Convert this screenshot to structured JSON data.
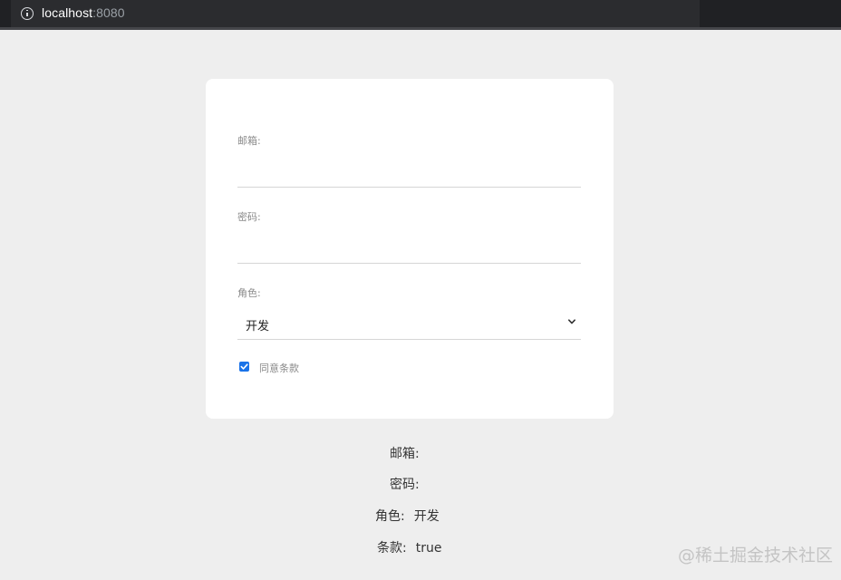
{
  "browser": {
    "url_host": "localhost",
    "url_port": ":8080"
  },
  "form": {
    "email_label": "邮箱:",
    "email_value": "",
    "password_label": "密码:",
    "password_value": "",
    "role_label": "角色:",
    "role_value": "开发",
    "terms_label": "同意条款",
    "terms_checked": true
  },
  "summary": {
    "email_label": "邮箱:",
    "email_value": "",
    "password_label": "密码:",
    "password_value": "",
    "role_label": "角色:",
    "role_value": "开发",
    "terms_label": "条款:",
    "terms_value": "true"
  },
  "watermark": "@稀土掘金技术社区"
}
